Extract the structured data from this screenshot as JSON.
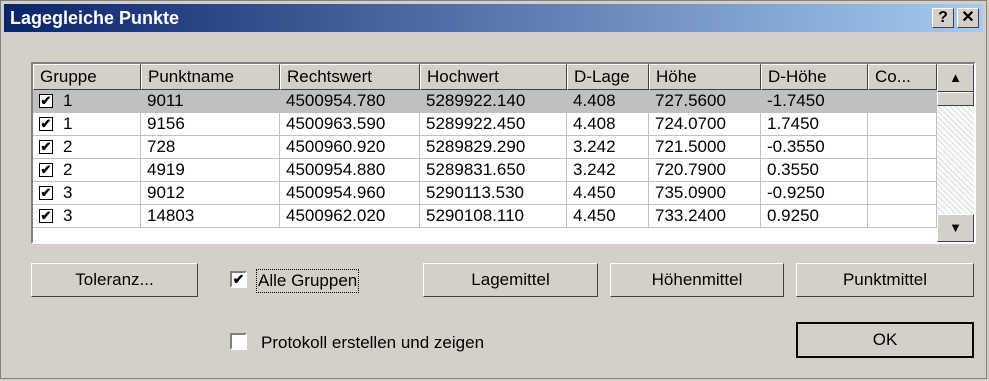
{
  "window": {
    "title": "Lagegleiche Punkte",
    "help_label": "?",
    "close_label": "✕"
  },
  "grid": {
    "columns": [
      "Gruppe",
      "Punktname",
      "Rechtswert",
      "Hochwert",
      "D-Lage",
      "Höhe",
      "D-Höhe",
      "Co..."
    ],
    "rows": [
      {
        "checked": "✔",
        "gruppe": "1",
        "punktname": "9011",
        "rechtswert": "4500954.780",
        "hochwert": "5289922.140",
        "dlage": "4.408",
        "hoehe": "727.5600",
        "dhoehe": "-1.7450",
        "co": ""
      },
      {
        "checked": "✔",
        "gruppe": "1",
        "punktname": "9156",
        "rechtswert": "4500963.590",
        "hochwert": "5289922.450",
        "dlage": "4.408",
        "hoehe": "724.0700",
        "dhoehe": "1.7450",
        "co": ""
      },
      {
        "checked": "✔",
        "gruppe": "2",
        "punktname": "728",
        "rechtswert": "4500960.920",
        "hochwert": "5289829.290",
        "dlage": "3.242",
        "hoehe": "721.5000",
        "dhoehe": "-0.3550",
        "co": ""
      },
      {
        "checked": "✔",
        "gruppe": "2",
        "punktname": "4919",
        "rechtswert": "4500954.880",
        "hochwert": "5289831.650",
        "dlage": "3.242",
        "hoehe": "720.7900",
        "dhoehe": "0.3550",
        "co": ""
      },
      {
        "checked": "✔",
        "gruppe": "3",
        "punktname": "9012",
        "rechtswert": "4500954.960",
        "hochwert": "5290113.530",
        "dlage": "4.450",
        "hoehe": "735.0900",
        "dhoehe": "-0.9250",
        "co": ""
      },
      {
        "checked": "✔",
        "gruppe": "3",
        "punktname": "14803",
        "rechtswert": "4500962.020",
        "hochwert": "5290108.110",
        "dlage": "4.450",
        "hoehe": "733.2400",
        "dhoehe": "0.9250",
        "co": ""
      }
    ],
    "scroll_up": "▲",
    "scroll_down": "▼"
  },
  "buttons": {
    "toleranz": "Toleranz...",
    "lagemittel": "Lagemittel",
    "hoehenmittel": "Höhenmittel",
    "punktmittel": "Punktmittel",
    "ok": "OK"
  },
  "options": {
    "alle_gruppen_label": "Alle Gruppen",
    "alle_gruppen_check": "✔",
    "protokoll_label": "Protokoll erstellen und zeigen"
  }
}
